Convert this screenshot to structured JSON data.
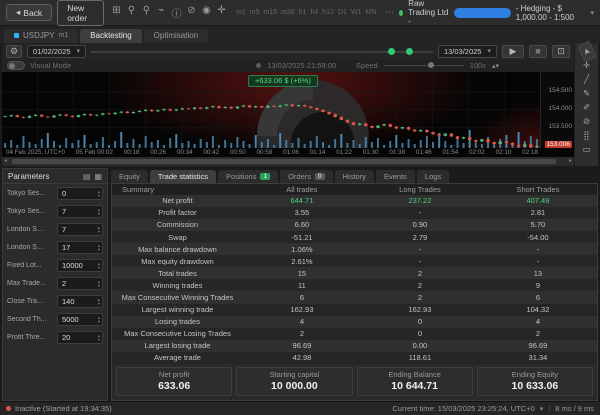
{
  "toolbar": {
    "back_label": "Back",
    "new_order_label": "New order",
    "icons": [
      {
        "name": "chart-grid-icon",
        "glyph": "⊞"
      },
      {
        "name": "zoom-in-icon",
        "glyph": "⚲"
      },
      {
        "name": "zoom-out-icon",
        "glyph": "⚲"
      },
      {
        "name": "announcement-icon",
        "glyph": "⌁"
      },
      {
        "name": "info-icon",
        "glyph": "ⓘ"
      },
      {
        "name": "disable-icon",
        "glyph": "⊘"
      },
      {
        "name": "eye-icon",
        "glyph": "◉"
      },
      {
        "name": "crosshair-icon",
        "glyph": "✛"
      }
    ],
    "timeframes": [
      "m1",
      "m5",
      "m15",
      "m30",
      "h1",
      "h4",
      "h12",
      "D1",
      "W1",
      "MN"
    ],
    "overflow": "⋯",
    "account": {
      "broker": "Raw Trading Ltd -",
      "suffix": "- Hedging - $ 1,000.00 - 1:500"
    }
  },
  "tabs": {
    "symbol": "USDJPY",
    "symbol_tf": "m1",
    "backtesting": "Backtesting",
    "optimisation": "Optimisation"
  },
  "controls": {
    "date_from": "01/02/2025",
    "date_to": "13/03/2025",
    "play": "▶",
    "stop": "■",
    "save": "⊡"
  },
  "visual": {
    "label": "Visual Mode",
    "datetime": "13/03/2025 21:59:00",
    "speed_label": "Speed",
    "speed_value": "100x"
  },
  "chart": {
    "badge": "+633.06 $ (+6%)",
    "price_axis": [
      {
        "label": "154.500",
        "price": 154.5
      },
      {
        "label": "154.000",
        "price": 154.0
      },
      {
        "label": "153.500",
        "price": 153.5
      },
      {
        "label": "153.000",
        "price": 153.0
      }
    ],
    "current_price": {
      "label": "153.006",
      "price": 153.01
    },
    "time_labels": [
      "04 Feb 2025, UTC+0",
      "05 Feb 00:02",
      "00:18",
      "00:26",
      "00:34",
      "00:42",
      "00:50",
      "00:58",
      "01:06",
      "01:14",
      "01:22",
      "01:30",
      "01:38",
      "01:46",
      "01:54",
      "02:02",
      "02:10",
      "02:18"
    ],
    "colors": {
      "up": "#4fba82",
      "down": "#e05647",
      "volume": "#4b87ae",
      "glow": "#6b1412"
    },
    "closes": [
      153.82,
      153.85,
      153.8,
      153.78,
      153.83,
      153.86,
      153.81,
      153.79,
      153.84,
      153.87,
      153.83,
      153.8,
      153.85,
      153.88,
      153.84,
      153.86,
      153.9,
      153.88,
      153.92,
      153.95,
      153.91,
      153.94,
      153.97,
      154.0,
      153.96,
      153.99,
      154.02,
      153.98,
      154.01,
      154.04,
      154.02,
      154.06,
      154.03,
      154.07,
      154.1,
      154.05,
      154.08,
      154.04,
      154.09,
      154.12,
      154.07,
      154.1,
      154.06,
      154.11,
      154.08,
      154.12,
      154.15,
      154.1,
      154.13,
      154.09,
      154.05,
      154.0,
      153.94,
      153.88,
      153.8,
      153.72,
      153.65,
      153.58,
      153.62,
      153.55,
      153.5,
      153.56,
      153.6,
      153.53,
      153.48,
      153.52,
      153.45,
      153.4,
      153.44,
      153.38,
      153.32,
      153.28,
      153.34,
      153.26,
      153.2,
      153.24,
      153.16,
      153.12,
      153.18,
      153.1,
      153.05,
      153.12,
      153.08,
      153.02,
      152.98,
      153.04,
      152.96,
      152.99
    ],
    "volumes": [
      5,
      8,
      3,
      12,
      6,
      4,
      9,
      15,
      7,
      3,
      10,
      5,
      8,
      13,
      4,
      6,
      11,
      3,
      7,
      16,
      5,
      9,
      4,
      12,
      6,
      8,
      3,
      10,
      14,
      5,
      7,
      4,
      9,
      6,
      12,
      3,
      8,
      5,
      11,
      7,
      4,
      13,
      6,
      9,
      3,
      15,
      8,
      5,
      10,
      4,
      7,
      12,
      6,
      3,
      9,
      14,
      5,
      8,
      4,
      11,
      6,
      10,
      3,
      7,
      13,
      5,
      9,
      4,
      8,
      12,
      6,
      15,
      7,
      3,
      10,
      5,
      18,
      8,
      4,
      11,
      6,
      9,
      13,
      5,
      16,
      7,
      12,
      9
    ]
  },
  "right_tools": [
    {
      "name": "cursor-icon",
      "glyph": "➤",
      "boxed": true
    },
    {
      "name": "crosshair-tool-icon",
      "glyph": "✛"
    },
    {
      "name": "trendline-icon",
      "glyph": "╱"
    },
    {
      "name": "pencil-icon",
      "glyph": "✎"
    },
    {
      "name": "brush-icon",
      "glyph": "✐"
    },
    {
      "name": "eraser-icon",
      "glyph": "⊘"
    },
    {
      "name": "pattern-icon",
      "glyph": "⣿"
    },
    {
      "name": "shapes-icon",
      "glyph": "▭"
    }
  ],
  "parameters": {
    "title": "Parameters",
    "items": [
      {
        "label": "Tokyo Ses...",
        "value": "0"
      },
      {
        "label": "Tokyo Ses...",
        "value": "7"
      },
      {
        "label": "London S...",
        "value": "7"
      },
      {
        "label": "London S...",
        "value": "17"
      },
      {
        "label": "Fixed Lot...",
        "value": "10000"
      },
      {
        "label": "Max Trade...",
        "value": "2"
      },
      {
        "label": "Close Tra...",
        "value": "140"
      },
      {
        "label": "Second Th...",
        "value": "5000"
      },
      {
        "label": "Profit Thre...",
        "value": "20"
      }
    ]
  },
  "stats": {
    "tabs": [
      {
        "label": "Equity"
      },
      {
        "label": "Trade statistics",
        "active": true
      },
      {
        "label": "Positions",
        "badge": "1",
        "badge_color": "#27a05c"
      },
      {
        "label": "Orders",
        "badge": "0",
        "badge_color": "#5a5a5a"
      },
      {
        "label": "History"
      },
      {
        "label": "Events"
      },
      {
        "label": "Logs"
      }
    ],
    "header": [
      "Summary",
      "All trades",
      "Long Trades",
      "Short Trades"
    ],
    "rows": [
      {
        "label": "Net profit",
        "all": "644.71",
        "long": "237.22",
        "short": "407.49",
        "green": true
      },
      {
        "label": "Profit factor",
        "all": "3.55",
        "long": "-",
        "short": "2.81"
      },
      {
        "label": "Commission",
        "all": "6.60",
        "long": "0.90",
        "short": "5.70"
      },
      {
        "label": "Swap",
        "all": "-51.21",
        "long": "2.79",
        "short": "-54.00"
      },
      {
        "label": "Max balance drawdown",
        "all": "1.06%",
        "long": "-",
        "short": "-"
      },
      {
        "label": "Max equity drawdown",
        "all": "2.61%",
        "long": "-",
        "short": "-"
      },
      {
        "label": "Total trades",
        "all": "15",
        "long": "2",
        "short": "13"
      },
      {
        "label": "Winning trades",
        "all": "11",
        "long": "2",
        "short": "9"
      },
      {
        "label": "Max Consecutive Winning Trades",
        "all": "6",
        "long": "2",
        "short": "6"
      },
      {
        "label": "Largest winning trade",
        "all": "162.93",
        "long": "162.93",
        "short": "104.32"
      },
      {
        "label": "Losing trades",
        "all": "4",
        "long": "0",
        "short": "4"
      },
      {
        "label": "Max Consecutive Losing Trades",
        "all": "2",
        "long": "0",
        "short": "2"
      },
      {
        "label": "Largest losing trade",
        "all": "96.69",
        "long": "0.00",
        "short": "96.69"
      },
      {
        "label": "Average trade",
        "all": "42.98",
        "long": "118.61",
        "short": "31.34"
      }
    ],
    "cards": [
      {
        "label": "Net profit",
        "value": "633.06"
      },
      {
        "label": "Starting capital",
        "value": "10 000.00"
      },
      {
        "label": "Ending Balance",
        "value": "10 644.71"
      },
      {
        "label": "Ending Equity",
        "value": "10 633.06"
      }
    ]
  },
  "statusbar": {
    "left": "Inactive (Started at 19:34:35)",
    "current_time": "Current time: 15/03/2025 23:25:24, UTC+0",
    "latency": "8 ms / 9 ms"
  }
}
